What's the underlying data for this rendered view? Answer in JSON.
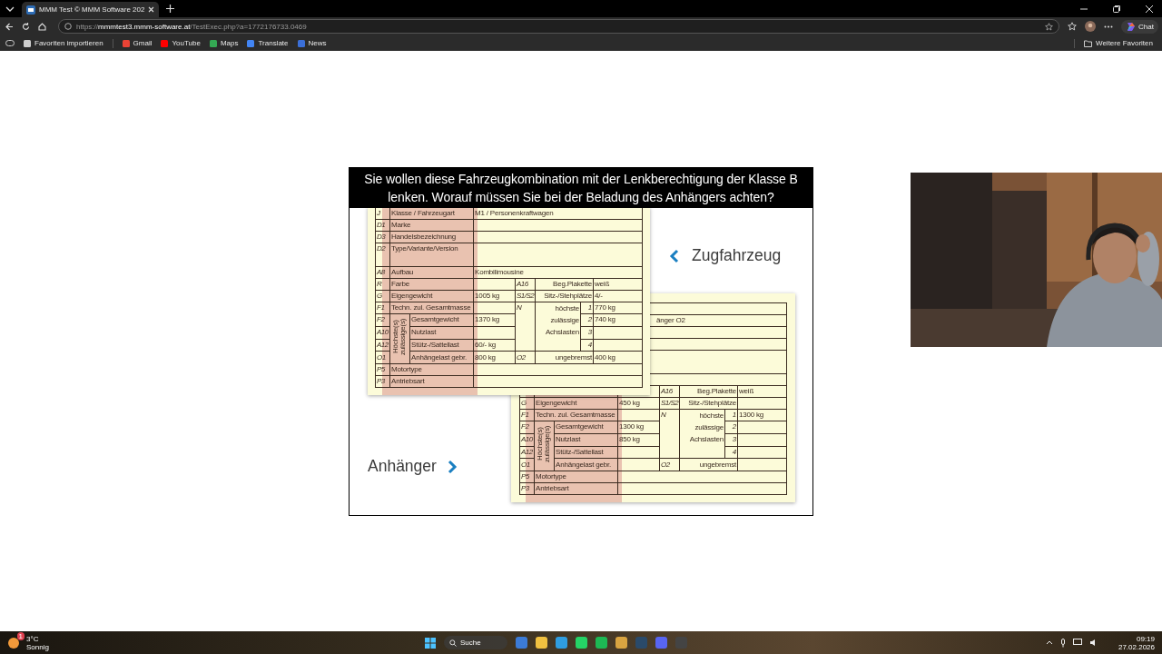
{
  "browser": {
    "tab_title": "MMM Test © MMM Software 202",
    "url": "https://**mmmtest3.mmm-software.at**/TestExec.php?a=1772176733.0469",
    "chat_label": "Chat",
    "bookmarks": [
      {
        "kind": "import",
        "label": "Favoriten importieren"
      },
      {
        "kind": "gmail",
        "label": "Gmail"
      },
      {
        "kind": "youtube",
        "label": "YouTube"
      },
      {
        "kind": "maps",
        "label": "Maps"
      },
      {
        "kind": "translate",
        "label": "Translate"
      },
      {
        "kind": "news",
        "label": "News"
      }
    ],
    "more_favorites": "Weitere Favoriten"
  },
  "question": {
    "text": "Sie wollen diese Fahrzeugkombination mit der Lenkberechtigung der Klasse B lenken. Worauf müssen Sie bei der Beladung des Anhängers achten?",
    "labels": [
      {
        "kind": "prev",
        "text": "Zugfahrzeug"
      },
      {
        "kind": "next",
        "text": "Anhänger"
      }
    ],
    "cards": [
      {
        "kind": "back",
        "rows": [
          {
            "kind": "wide"
          },
          {
            "kind": "wide",
            "value": "änger O2"
          },
          {
            "kind": "wide"
          },
          {
            "kind": "wide"
          },
          {
            "kind": "tall"
          },
          {
            "kind": "wide"
          },
          {
            "kind": "pair",
            "code2": "A16",
            "label2": "Beg.Plakette",
            "value2": "weiß"
          },
          {
            "kind": "pair",
            "code": "G",
            "label": "Eigengewicht",
            "value": "450 kg",
            "code2": "S1/S2",
            "label2": "Sitz-/Stehplätze"
          },
          {
            "kind": "axle_head",
            "code": "F1",
            "label": "Techn. zul. Gesamtmasse",
            "code2": "N",
            "label2": [
              "höchste",
              "zulässige",
              "Achslasten"
            ],
            "num": "1",
            "value2": "1300 kg"
          },
          {
            "kind": "group_head",
            "code": "F2",
            "group_label": "Höchste(s) zulässige(s)",
            "label": "Gesamtgewicht",
            "value": "1300 kg",
            "num": "2"
          },
          {
            "kind": "group",
            "code": "A10",
            "label": "Nutzlast",
            "value": "850 kg",
            "num": "3"
          },
          {
            "kind": "group",
            "code": "A12",
            "label": "Stütz-/Sattellast",
            "num": "4"
          },
          {
            "kind": "group_pair",
            "code": "O1",
            "label": "Anhängelast gebr.",
            "code2": "O2",
            "label2": "ungebremst"
          },
          {
            "kind": "wide",
            "code": "P5",
            "label": "Motortype"
          },
          {
            "kind": "wide",
            "code": "P3",
            "label": "Antriebsart"
          }
        ]
      },
      {
        "kind": "front",
        "rows": [
          {
            "kind": "wide",
            "code": "J",
            "label": "Klasse / Fahrzeugart",
            "value": "M1 / Personenkraftwagen"
          },
          {
            "kind": "wide",
            "code": "D1",
            "label": "Marke"
          },
          {
            "kind": "wide",
            "code": "D3",
            "label": "Handelsbezeichnung"
          },
          {
            "kind": "tall",
            "code": "D2",
            "label": "Type/Variante/Version"
          },
          {
            "kind": "wide",
            "code": "A8",
            "label": "Aufbau",
            "value": "Kombilimousine"
          },
          {
            "kind": "pair",
            "code": "R",
            "label": "Farbe",
            "code2": "A16",
            "label2": "Beg.Plakette",
            "value2": "weiß"
          },
          {
            "kind": "pair",
            "code": "G",
            "label": "Eigengewicht",
            "value": "1005 kg",
            "code2": "S1/S2",
            "label2": "Sitz-/Stehplätze",
            "value2": "4/-"
          },
          {
            "kind": "axle_head",
            "code": "F1",
            "label": "Techn. zul. Gesamtmasse",
            "code2": "N",
            "label2": [
              "höchste",
              "zulässige",
              "Achslasten"
            ],
            "num": "1",
            "value2": "770 kg"
          },
          {
            "kind": "group_head",
            "code": "F2",
            "group_label": "Höchste(s) zulässige(s)",
            "label": "Gesamtgewicht",
            "value": "1370 kg",
            "num": "2",
            "value2": "740 kg"
          },
          {
            "kind": "group",
            "code": "A10",
            "label": "Nutzlast",
            "num": "3"
          },
          {
            "kind": "group",
            "code": "A12",
            "label": "Stütz-/Sattellast",
            "value": "60/- kg",
            "num": "4"
          },
          {
            "kind": "group_pair",
            "code": "O1",
            "label": "Anhängelast gebr.",
            "value": "800 kg",
            "code2": "O2",
            "label2": "ungebremst",
            "value2": "400 kg"
          },
          {
            "kind": "wide",
            "code": "P5",
            "label": "Motortype"
          },
          {
            "kind": "wide",
            "code": "P3",
            "label": "Antriebsart"
          }
        ]
      }
    ]
  },
  "taskbar": {
    "weather_badge": "1",
    "weather_temp": "3°C",
    "weather_text": "Sonnig",
    "search_placeholder": "Suche",
    "time": "09:19",
    "date": "27.02.2026"
  }
}
